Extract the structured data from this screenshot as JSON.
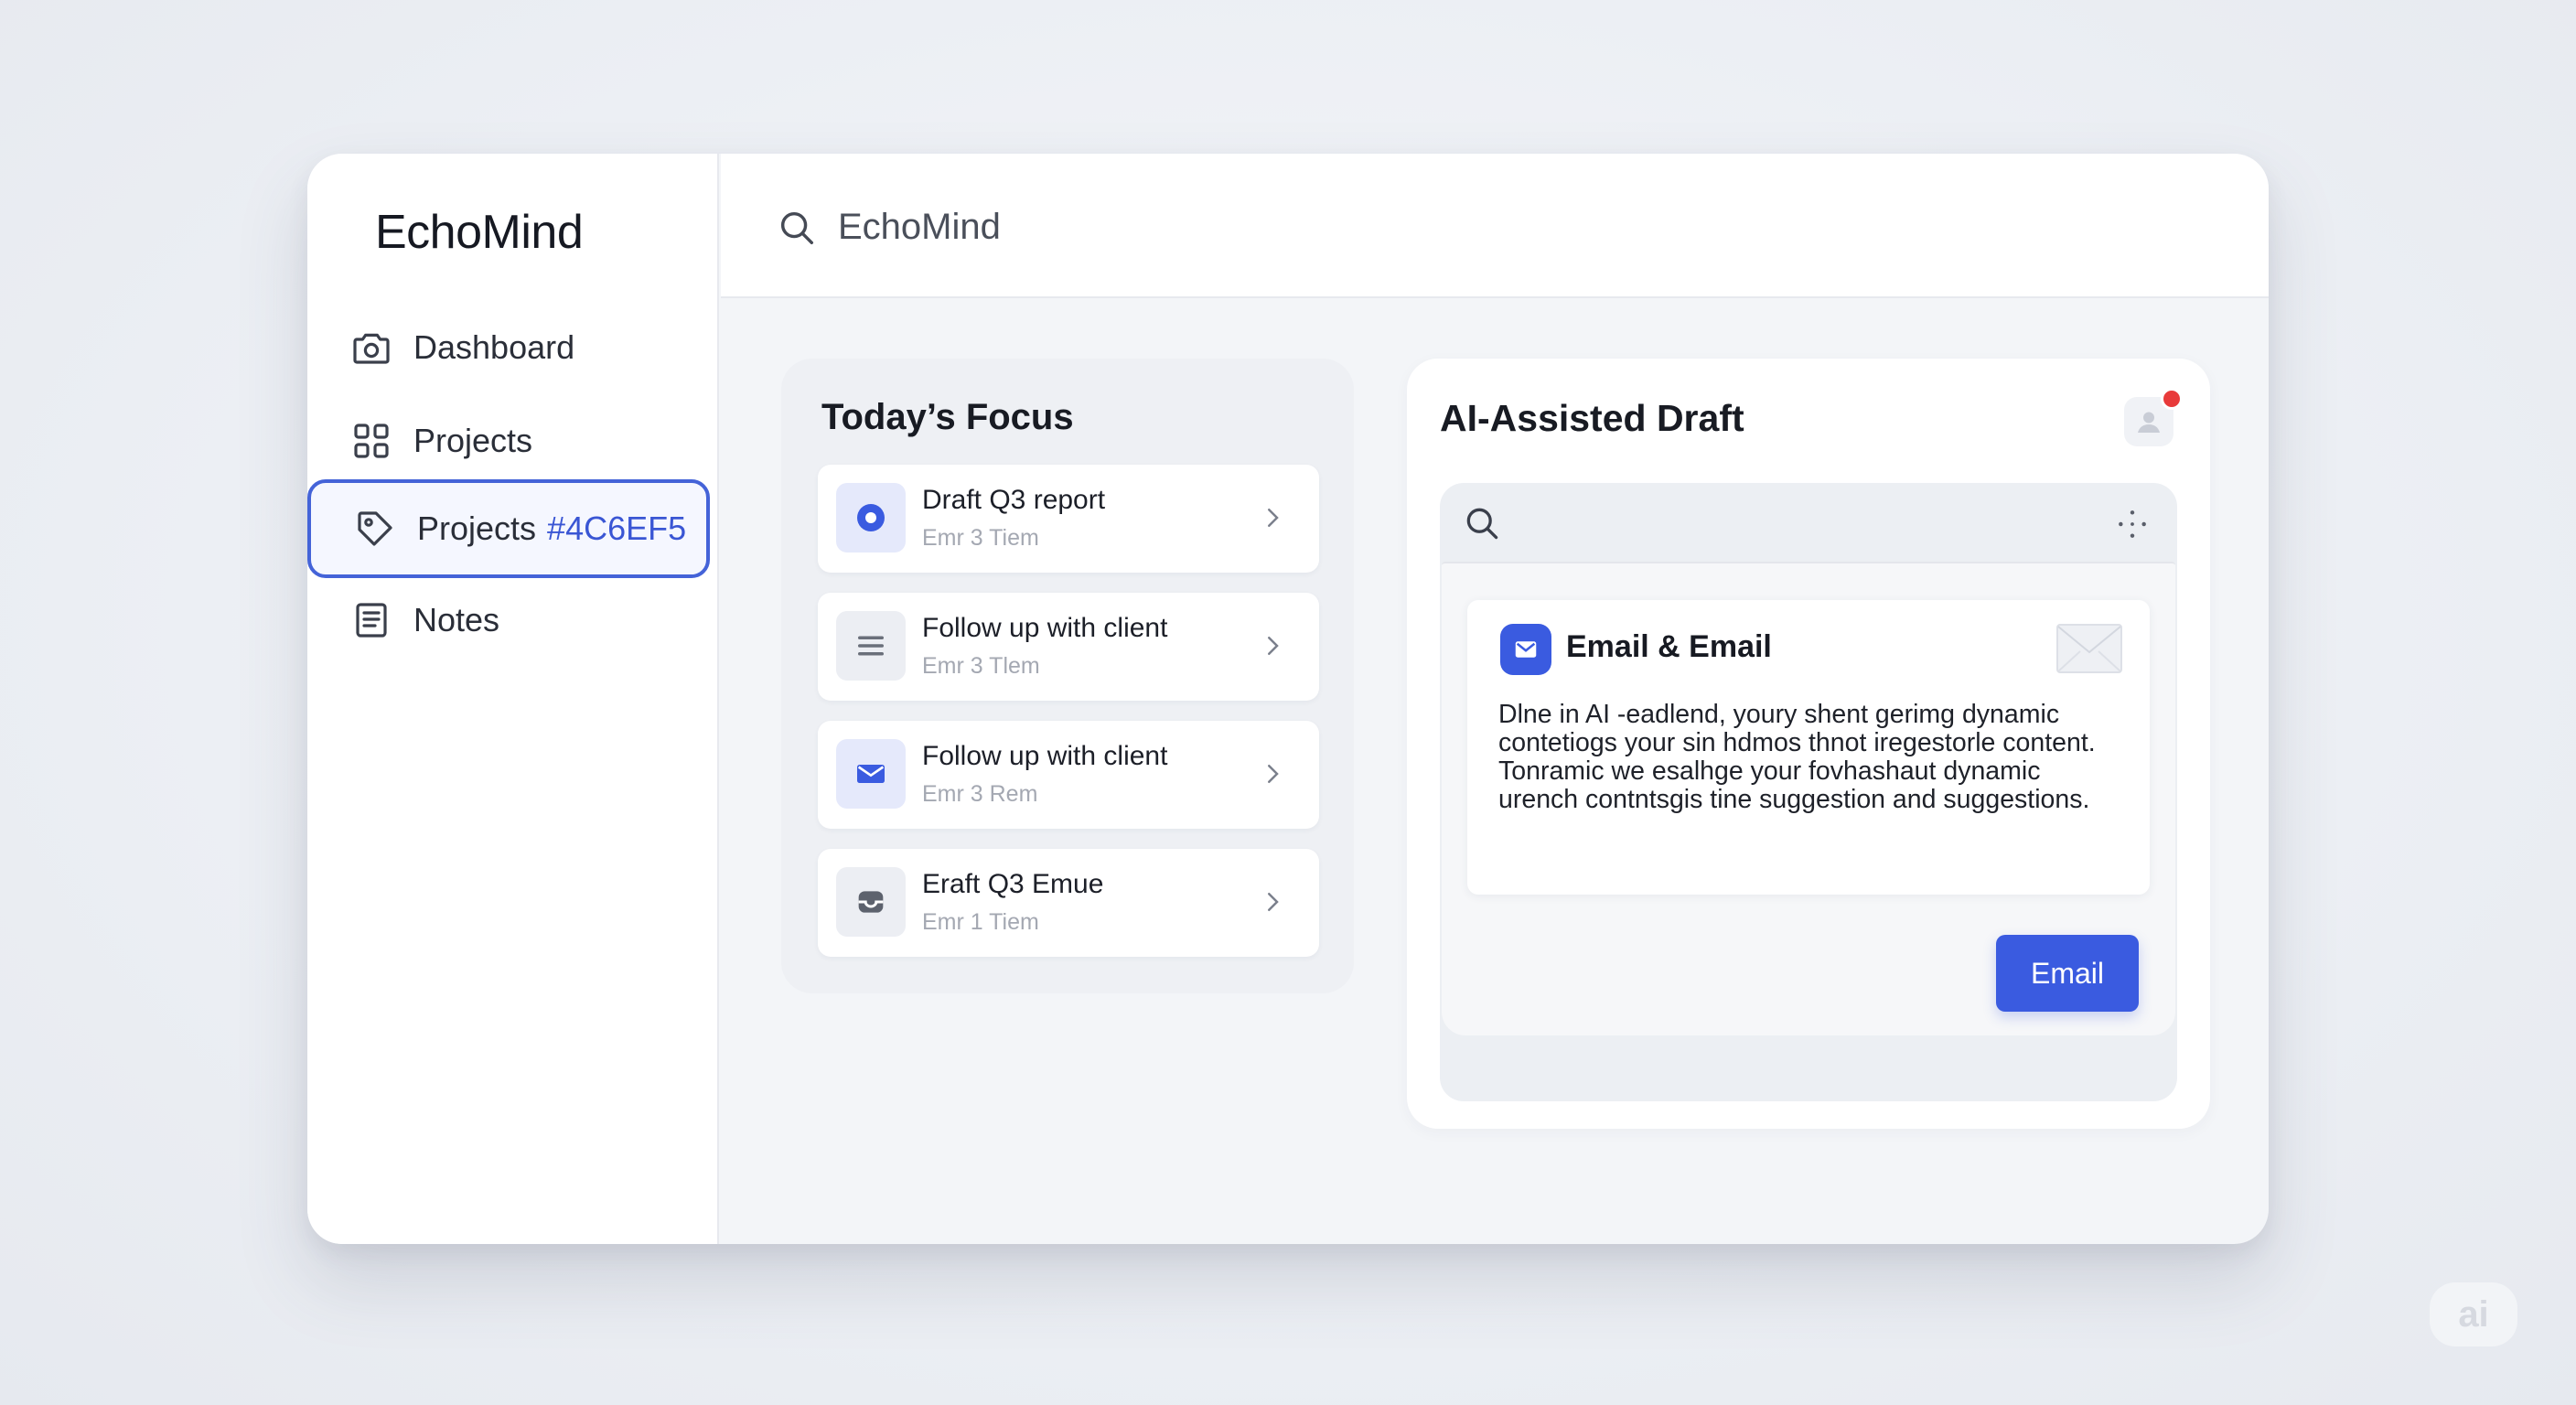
{
  "app": {
    "name": "EchoMind"
  },
  "sidebar": {
    "items": [
      {
        "label": "Dashboard",
        "icon": "camera-icon"
      },
      {
        "label": "Projects",
        "icon": "grid-icon"
      },
      {
        "label": "Projects",
        "hash": "#4C6EF5",
        "icon": "tag-icon",
        "active": true
      },
      {
        "label": "Notes",
        "icon": "notes-icon"
      }
    ]
  },
  "header": {
    "search_value": "EchoMind",
    "avatars": [
      {
        "name": "user-avatar-1",
        "badge": "1"
      },
      {
        "name": "user-avatar-2"
      }
    ]
  },
  "focus": {
    "title": "Today’s Focus",
    "tasks": [
      {
        "title": "Draft Q3 report",
        "meta": "Emr 3 Tiem",
        "icon": "location-icon"
      },
      {
        "title": "Follow up with client",
        "meta": "Emr 3 Tlem",
        "icon": "menu-lines-icon"
      },
      {
        "title": "Follow up with client",
        "meta": "Emr 3 Rem",
        "icon": "mail-icon"
      },
      {
        "title": "Eraft Q3 Emue",
        "meta": "Emr 1 Tiem",
        "icon": "inbox-icon"
      }
    ]
  },
  "draft": {
    "title": "AI-Assisted Draft",
    "email": {
      "heading": "Email & Email",
      "body": "Dlne in AI -eadlend, youry shent gerimg dynamic contetiogs your sin hdmos thnot iregestorle content. Tonramic we esalhge your fovhashaut dynamic urench contntsgis tine suggestion and suggestions.",
      "button_label": "Email"
    }
  },
  "watermark": "ai",
  "colors": {
    "accent": "#3a5be0",
    "active_border": "#4463d8",
    "badge": "#e83a3a"
  }
}
